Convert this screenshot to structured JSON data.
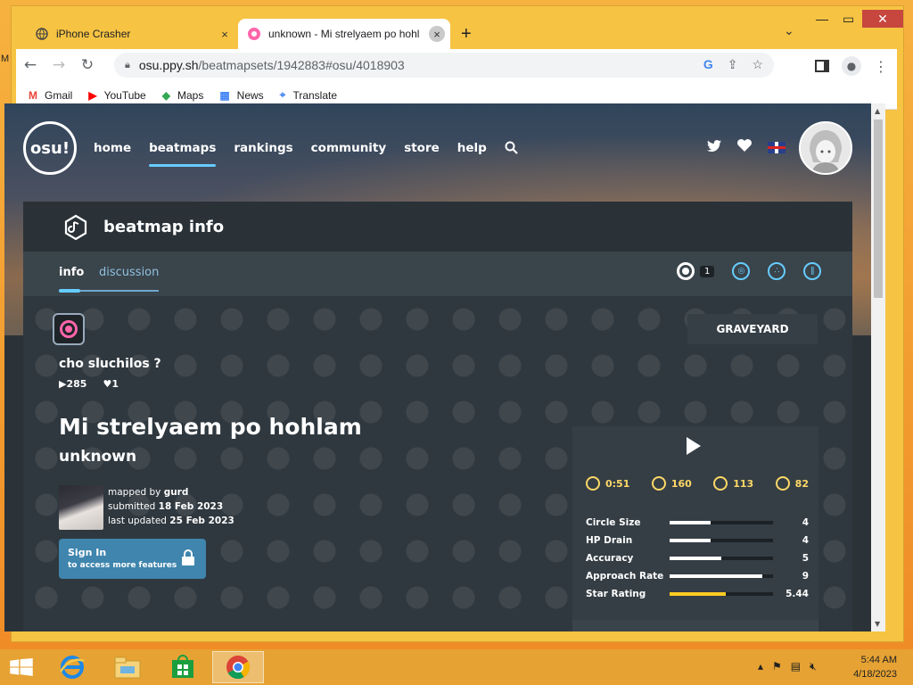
{
  "browser": {
    "tabs": [
      {
        "title": "iPhone Crasher",
        "close": "×"
      },
      {
        "title": "unknown - Mi strelyaem po hohl",
        "close": "×"
      }
    ],
    "new_tab": "+",
    "url_host": "osu.ppy.sh",
    "url_path": "/beatmapsets/1942883#osu/4018903",
    "bookmarks": [
      {
        "label": "Gmail",
        "icon": "gmail-icon"
      },
      {
        "label": "YouTube",
        "icon": "youtube-icon"
      },
      {
        "label": "Maps",
        "icon": "maps-icon"
      },
      {
        "label": "News",
        "icon": "news-icon"
      },
      {
        "label": "Translate",
        "icon": "translate-icon"
      }
    ]
  },
  "desktop": {
    "left_label": "M"
  },
  "site": {
    "logo": "osu!",
    "nav": [
      "home",
      "beatmaps",
      "rankings",
      "community",
      "store",
      "help"
    ],
    "active_nav": "beatmaps"
  },
  "header": {
    "title": "beatmap info"
  },
  "page_tabs": {
    "info": "info",
    "discussion": "discussion",
    "mode_count": "1"
  },
  "beatmap": {
    "status": "GRAVEYARD",
    "difficulty_name": "cho sluchilos ?",
    "play_count": "285",
    "favourite_count": "1",
    "title": "Mi strelyaem po hohlam",
    "artist": "unknown",
    "mapped_by_label": "mapped by",
    "mapper": "gurd",
    "submitted_label": "submitted",
    "submitted": "18 Feb 2023",
    "updated_label": "last updated",
    "updated": "25 Feb 2023"
  },
  "signin": {
    "title": "Sign In",
    "subtitle": "to access more features"
  },
  "basic_stats": {
    "length": "0:51",
    "bpm": "160",
    "circles": "113",
    "sliders": "82"
  },
  "attributes": [
    {
      "label": "Circle Size",
      "value": "4",
      "fraction": 0.4
    },
    {
      "label": "HP Drain",
      "value": "4",
      "fraction": 0.4
    },
    {
      "label": "Accuracy",
      "value": "5",
      "fraction": 0.5
    },
    {
      "label": "Approach Rate",
      "value": "9",
      "fraction": 0.9
    },
    {
      "label": "Star Rating",
      "value": "5.44",
      "fraction": 0.544
    }
  ],
  "taskbar": {
    "time": "5:44 AM",
    "date": "4/18/2023"
  },
  "colors": {
    "accent": "#66ccff",
    "pink": "#ff66aa",
    "star": "#ffcc22",
    "stat_yellow": "#ffd966",
    "signin": "#3f85ad"
  }
}
